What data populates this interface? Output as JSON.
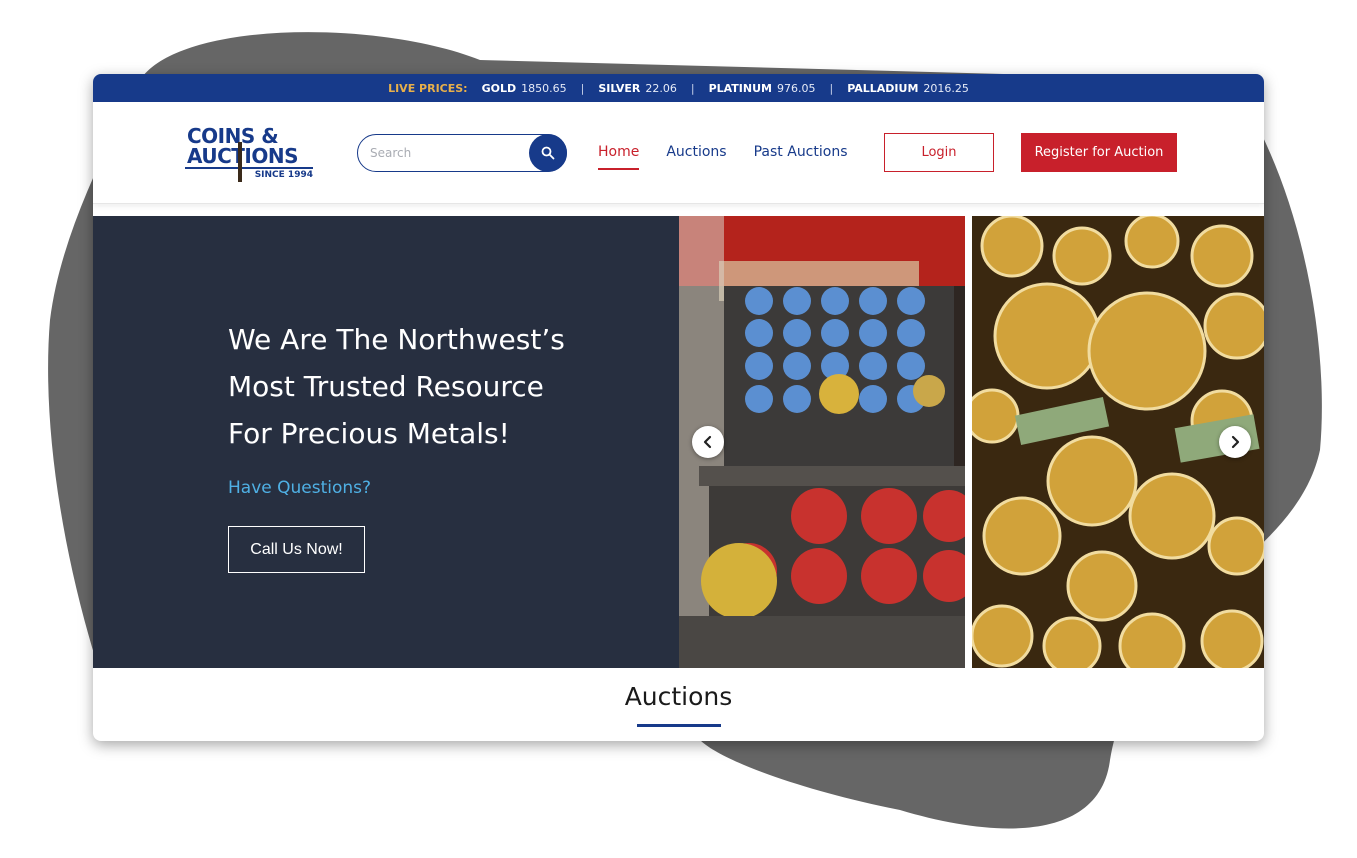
{
  "ticker": {
    "live_label": "LIVE PRICES:",
    "separator": "|",
    "metals": [
      {
        "name": "GOLD",
        "price": "1850.65"
      },
      {
        "name": "SILVER",
        "price": "22.06"
      },
      {
        "name": "PLATINUM",
        "price": "976.05"
      },
      {
        "name": "PALLADIUM",
        "price": "2016.25"
      }
    ]
  },
  "logo": {
    "line1": "COINS &",
    "line2": "AUCTIONS",
    "since": "SINCE 1994"
  },
  "search": {
    "placeholder": "Search"
  },
  "nav": {
    "items": [
      {
        "label": "Home",
        "active": true
      },
      {
        "label": "Auctions",
        "active": false
      },
      {
        "label": "Past Auctions",
        "active": false
      }
    ]
  },
  "buttons": {
    "login": "Login",
    "register": "Register for Auction"
  },
  "hero": {
    "title_line1": "We Are The Northwest’s",
    "title_line2": "Most Trusted Resource",
    "title_line3": "For Precious Metals!",
    "questions": "Have Questions?",
    "cta": "Call Us Now!"
  },
  "carousel": {
    "prev_icon": "chevron-left-icon",
    "next_icon": "chevron-right-icon"
  },
  "section": {
    "title": "Auctions"
  },
  "colors": {
    "navy": "#173a8a",
    "red": "#c8202b",
    "hero_bg": "#272f40",
    "accent_blue": "#4fb0e4",
    "gold": "#e8b04a",
    "blob": "#666666"
  }
}
